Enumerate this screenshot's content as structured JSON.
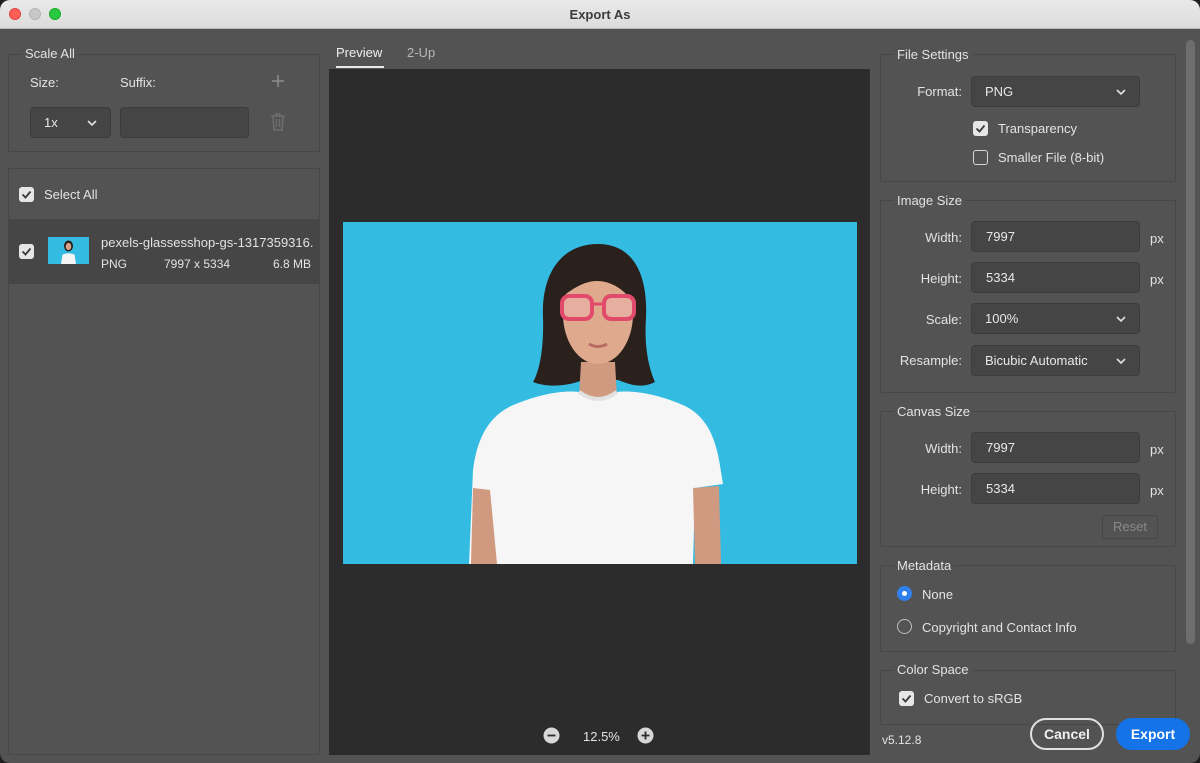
{
  "window": {
    "title": "Export As"
  },
  "scale_all": {
    "title": "Scale All",
    "size_label": "Size:",
    "suffix_label": "Suffix:",
    "size_value": "1x",
    "suffix_value": ""
  },
  "assets": {
    "select_all_label": "Select All",
    "items": [
      {
        "name": "pexels-glassesshop-gs-1317359316...",
        "format": "PNG",
        "dimensions": "7997 x 5334",
        "size": "6.8 MB"
      }
    ]
  },
  "preview": {
    "tabs": [
      "Preview",
      "2-Up"
    ],
    "active_tab": "Preview",
    "zoom": "12.5%"
  },
  "file_settings": {
    "title": "File Settings",
    "format_label": "Format:",
    "format_value": "PNG",
    "transparency_label": "Transparency",
    "transparency_checked": true,
    "smaller_file_label": "Smaller File (8-bit)",
    "smaller_file_checked": false
  },
  "image_size": {
    "title": "Image Size",
    "width_label": "Width:",
    "width_value": "7997",
    "height_label": "Height:",
    "height_value": "5334",
    "unit": "px",
    "scale_label": "Scale:",
    "scale_value": "100%",
    "resample_label": "Resample:",
    "resample_value": "Bicubic Automatic"
  },
  "canvas_size": {
    "title": "Canvas Size",
    "width_label": "Width:",
    "width_value": "7997",
    "height_label": "Height:",
    "height_value": "5334",
    "unit": "px",
    "reset_label": "Reset"
  },
  "metadata": {
    "title": "Metadata",
    "options": [
      "None",
      "Copyright and Contact Info"
    ],
    "selected": "None"
  },
  "color_space": {
    "title": "Color Space",
    "convert_label": "Convert to sRGB",
    "convert_checked": true
  },
  "footer": {
    "version": "v5.12.8",
    "cancel_label": "Cancel",
    "export_label": "Export"
  },
  "colors": {
    "accent": "#1473e6",
    "radio_selected": "#2f80ed",
    "preview_background": "#33bbe2",
    "panel": "#535353"
  },
  "icons": [
    "plus-icon",
    "trash-icon",
    "chevron-down-icon",
    "checkmark-icon",
    "zoom-out-icon",
    "zoom-in-icon"
  ]
}
